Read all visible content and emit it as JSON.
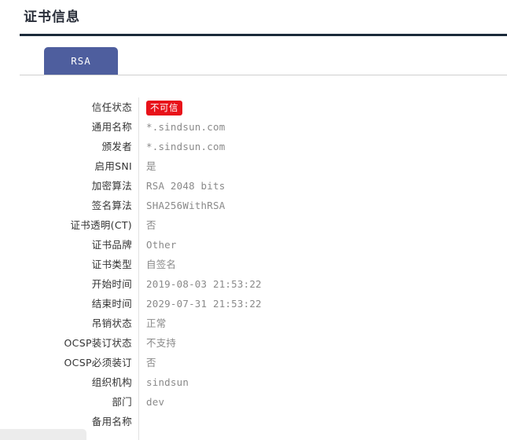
{
  "header": {
    "title": "证书信息"
  },
  "tabs": [
    {
      "label": "RSA",
      "active": true
    }
  ],
  "colors": {
    "tab_active_bg": "#4e5e9e",
    "title_rule": "#1b2a3a",
    "badge_untrusted_bg": "#e8121a",
    "value_text": "#8a8a8a",
    "label_text": "#333333",
    "divider": "#e2e2e2"
  },
  "details": [
    {
      "label": "信任状态",
      "value": "不可信",
      "type": "badge"
    },
    {
      "label": "通用名称",
      "value": "*.sindsun.com",
      "type": "text"
    },
    {
      "label": "颁发者",
      "value": "*.sindsun.com",
      "type": "text"
    },
    {
      "label": "启用SNI",
      "value": "是",
      "type": "text"
    },
    {
      "label": "加密算法",
      "value": "RSA 2048 bits",
      "type": "text"
    },
    {
      "label": "签名算法",
      "value": "SHA256WithRSA",
      "type": "text"
    },
    {
      "label": "证书透明(CT)",
      "value": "否",
      "type": "text"
    },
    {
      "label": "证书品牌",
      "value": "Other",
      "type": "text"
    },
    {
      "label": "证书类型",
      "value": "自签名",
      "type": "text"
    },
    {
      "label": "开始时间",
      "value": "2019-08-03 21:53:22",
      "type": "text"
    },
    {
      "label": "结束时间",
      "value": "2029-07-31 21:53:22",
      "type": "text"
    },
    {
      "label": "吊销状态",
      "value": "正常",
      "type": "text"
    },
    {
      "label": "OCSP装订状态",
      "value": "不支持",
      "type": "text"
    },
    {
      "label": "OCSP必须装订",
      "value": "否",
      "type": "text"
    },
    {
      "label": "组织机构",
      "value": "sindsun",
      "type": "text"
    },
    {
      "label": "部门",
      "value": "dev",
      "type": "text"
    },
    {
      "label": "备用名称",
      "value": "",
      "type": "text"
    }
  ]
}
